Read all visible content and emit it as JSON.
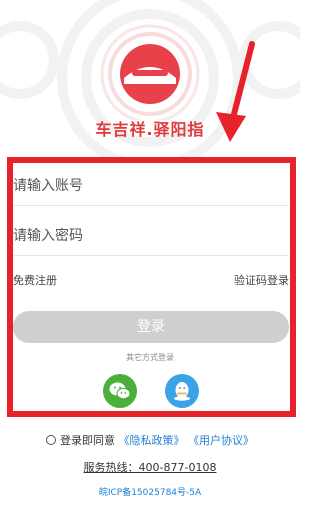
{
  "brand": {
    "name": "车吉祥.驿阳指",
    "logo_icon": "car-logo-icon",
    "color": "#e0393e"
  },
  "login_form": {
    "account_placeholder": "请输入账号",
    "password_placeholder": "请输入密码",
    "register_link": "免费注册",
    "code_login_link": "验证码登录",
    "login_button": "登录",
    "other_methods": "其它方式登录"
  },
  "social": {
    "wechat": {
      "icon": "wechat-icon",
      "color": "#4caf3a"
    },
    "qq": {
      "icon": "qq-icon",
      "color": "#3aa3e8"
    }
  },
  "agreement": {
    "prefix": "登录即同意",
    "privacy": "《隐私政策》",
    "terms": "《用户协议》"
  },
  "footer": {
    "hotline": "服务热线：400-877-0108",
    "icp": "皖ICP备15025784号-5A"
  },
  "colors": {
    "highlight": "#e8222a",
    "link": "#1f7fd6",
    "button_disabled": "#cfcfcf"
  }
}
